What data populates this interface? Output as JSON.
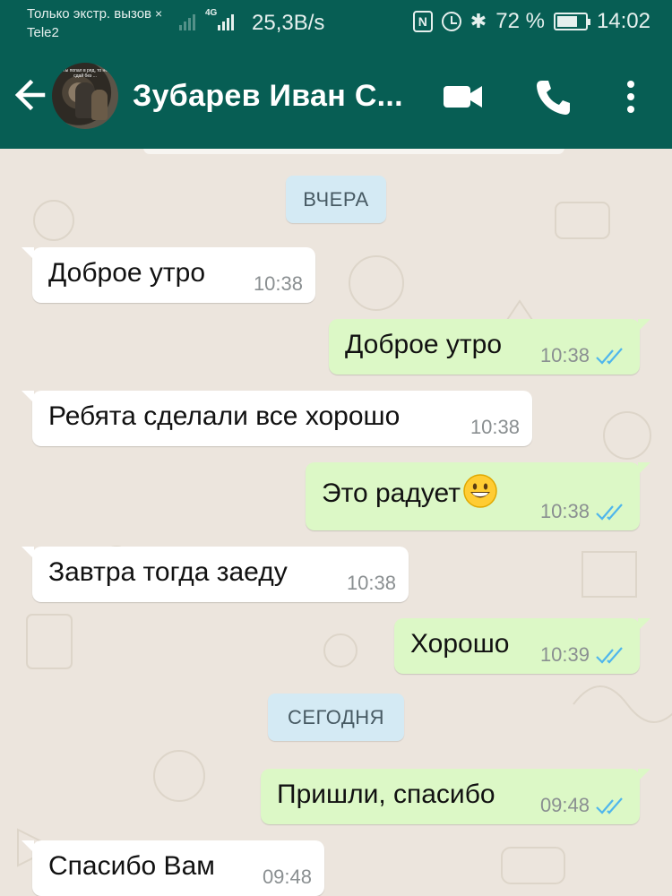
{
  "status_bar": {
    "line1": "Только экстр. вызов",
    "x_mark": "×",
    "carrier": "Tele2",
    "network": "4G",
    "speed": "25,3B/s",
    "nfc": "N",
    "bluetooth": "✱",
    "battery_pct": "72 %",
    "battery_level": 0.72,
    "time": "14:02"
  },
  "header": {
    "contact_name": "Зубарев Иван С...",
    "avatar_caption": "Ты попал в ряд, то не сдай без ...",
    "icons": [
      "back-arrow-icon",
      "video-call-icon",
      "phone-icon",
      "more-vert-icon"
    ]
  },
  "chat": {
    "date_yesterday": "ВЧЕРА",
    "date_today": "СЕГОДНЯ",
    "messages": [
      {
        "dir": "in",
        "text": "Доброе утро",
        "time": "10:38"
      },
      {
        "dir": "out",
        "text": "Доброе утро",
        "time": "10:38",
        "read": true
      },
      {
        "dir": "in",
        "text": "Ребята сделали все хорошо",
        "time": "10:38"
      },
      {
        "dir": "out",
        "text": "Это радует",
        "emoji": "grinning-face",
        "time": "10:38",
        "read": true
      },
      {
        "dir": "in",
        "text": "Завтра тогда заеду",
        "time": "10:38"
      },
      {
        "dir": "out",
        "text": "Хорошо",
        "time": "10:39",
        "read": true
      },
      {
        "dir": "out",
        "text": "Пришли, спасибо",
        "time": "09:48",
        "read": true
      },
      {
        "dir": "in",
        "text": "Спасибо Вам",
        "time": "09:48"
      }
    ]
  },
  "colors": {
    "header": "#075e54",
    "incoming_bubble": "#ffffff",
    "outgoing_bubble": "#dcf8c6",
    "read_ticks": "#4fb6ec",
    "date_chip": "#d4eaf4"
  }
}
